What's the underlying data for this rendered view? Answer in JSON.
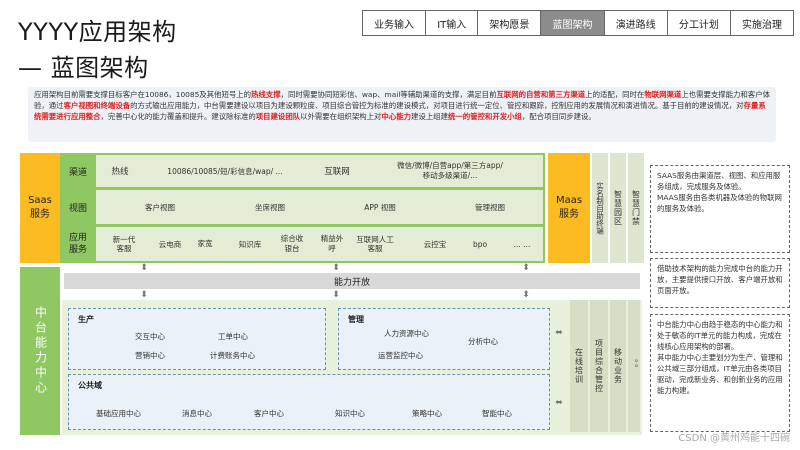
{
  "title": {
    "line1": "YYYY应用架构",
    "line2": "— 蓝图架构"
  },
  "steps": [
    "业务输入",
    "IT输入",
    "架构愿景",
    "蓝图架构",
    "演进路线",
    "分工计划",
    "实施治理"
  ],
  "active_step": "蓝图架构",
  "intro": {
    "p1": "应用架构目前需要支撑目标客户在10086，10085及其他短号上的",
    "h1": "热线支撑",
    "p2": "，同时需要协同短彩信、wap、mail等辅助渠道的支撑，满足目前",
    "h2": "互联网的自营和第三方渠道",
    "p3": "上的适配，同时在",
    "h3": "物联网渠道",
    "p4": "上也需要支撑能力和客户体验，通过",
    "h4": "客户视图和终端设备",
    "p5": "的方式输出应用能力，中台需要建设以项目为建设颗粒度、项目综合管控为标准的建设模式，对项目进行统一定位、管控和跟踪，控制应用的发展情况和演进情况。基于目前的建设情况，对",
    "h5": "存量系统需要进行应用整合",
    "p6": "，完善中心化的能力覆盖和提升。建议除标准的",
    "h6": "项目建设团队",
    "p7": "以外需要在组织架构上对",
    "h7": "中心能力",
    "p8": "建设上组建",
    "h8": "统一的管控和开发小组",
    "p9": "，配合项目同步建设。"
  },
  "saas": {
    "label": "Saas\n服务",
    "rows": [
      {
        "label": "渠道",
        "items": [
          "热线",
          "10086/10085/短/彩信息/wap/ ...",
          "互联网",
          "微信/微博/自营app/第三方app/\n移动多级渠道/..."
        ]
      },
      {
        "label": "视图",
        "items": [
          "客户视图",
          "坐席视图",
          "APP 视图",
          "管理视图"
        ]
      },
      {
        "label": "应用\n服务",
        "items": [
          "新一代客服",
          "云电商",
          "家宽",
          "知识库",
          "综合收银台",
          "精益外呼",
          "互联网人工客服",
          "云控宝",
          "bpo",
          "... ..."
        ]
      }
    ]
  },
  "maas": {
    "label": "Maas\n服务",
    "cols": [
      "实名制自助终端",
      "智慧园区",
      "智慧门禁"
    ]
  },
  "capability_open": "能力开放",
  "middle": {
    "label": "中台能力中心",
    "production": {
      "title": "生产",
      "items": [
        "交互中心",
        "工单中心",
        "营销中心",
        "计费账务中心"
      ]
    },
    "management": {
      "title": "管理",
      "items": [
        "人力资源中心",
        "分析中心",
        "运营监控中心"
      ]
    },
    "common": {
      "title": "公共域",
      "items": [
        "基础应用中心",
        "消息中心",
        "客户中心",
        "知识中心",
        "策略中心",
        "智能中心"
      ]
    },
    "side_cols": [
      "在线培训",
      "项目综合管控",
      "移动业务",
      "。。"
    ]
  },
  "notes": [
    "SAAS服务由渠道层、视图、和应用服务组成，完成服务及体验。\nMAAS服务由各类机器及体验的物联网的服务及体验。",
    "借助技术架构的能力完成中台的能力开放，主要提供接口开放、客户端开放和页面开放。",
    "中台能力中心由趋于稳态的中心能力和处于敏态的IT单元的能力构成，完成在线核心应用架构的部署。\n其中能力中心主要划分为生产、管理和公共域三部分组成，IT单元由各类项目驱动，完成新业务、和创新业务的应用能力构建。"
  ],
  "watermark": "CSDN @黄州鸡能十四碗"
}
